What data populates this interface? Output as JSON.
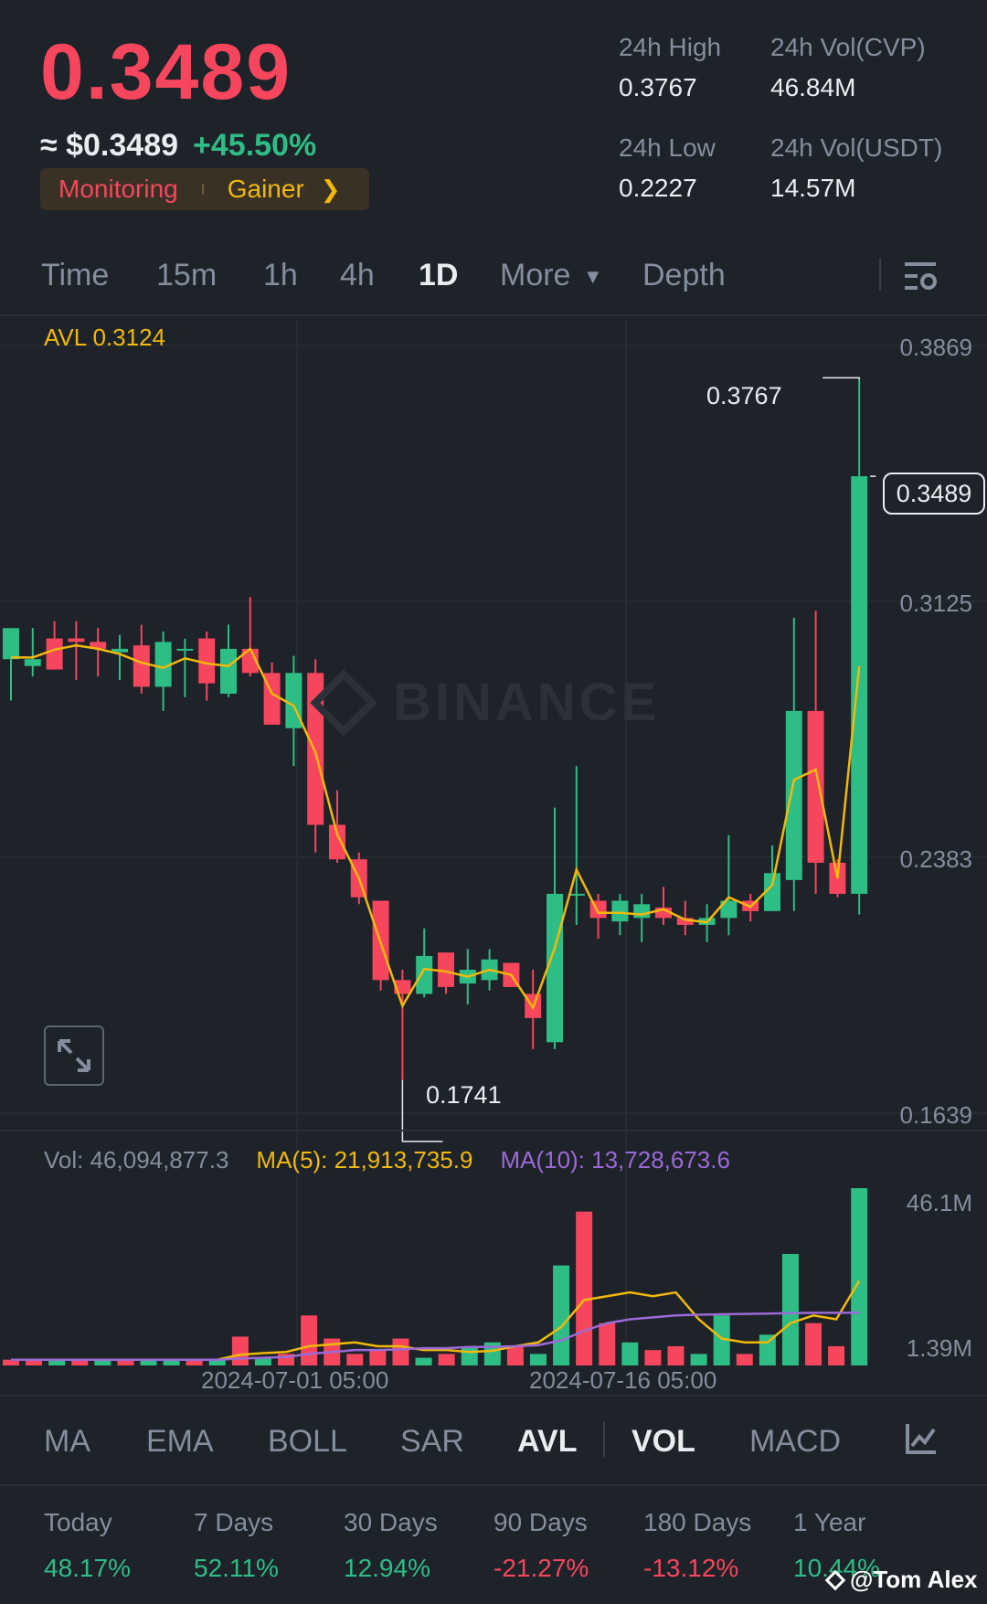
{
  "header": {
    "price": "0.3489",
    "approx": "≈ $0.3489",
    "change": "+45.50%",
    "tag_monitoring": "Monitoring",
    "tag_gainer": "Gainer",
    "stats": {
      "high_label": "24h High",
      "high_value": "0.3767",
      "low_label": "24h Low",
      "low_value": "0.2227",
      "vol_cvp_label": "24h Vol(CVP)",
      "vol_cvp_value": "46.84M",
      "vol_usdt_label": "24h Vol(USDT)",
      "vol_usdt_value": "14.57M"
    }
  },
  "timeframes": [
    "Time",
    "15m",
    "1h",
    "4h",
    "1D",
    "More",
    "Depth"
  ],
  "active_timeframe": "1D",
  "chart": {
    "avl_label": "AVL 0.3124",
    "y_labels": [
      "0.3869",
      "0.3125",
      "0.2383",
      "0.1639"
    ],
    "current_price_badge": "0.3489",
    "high_marker": "0.3767",
    "low_marker": "0.1741",
    "watermark": "BINANCE",
    "vol_legend": {
      "vol": "Vol: 46,094,877.3",
      "ma5": "MA(5): 21,913,735.9",
      "ma10": "MA(10): 13,728,673.6"
    },
    "vol_y_labels": [
      "46.1M",
      "1.39M"
    ],
    "date_labels": [
      "2024-07-01 05:00",
      "2024-07-16 05:00"
    ]
  },
  "indicators": [
    "MA",
    "EMA",
    "BOLL",
    "SAR",
    "AVL",
    "VOL",
    "MACD"
  ],
  "active_indicators": [
    "AVL",
    "VOL"
  ],
  "periods": [
    {
      "label": "Today",
      "value": "48.17%",
      "dir": "pos"
    },
    {
      "label": "7 Days",
      "value": "52.11%",
      "dir": "pos"
    },
    {
      "label": "30 Days",
      "value": "12.94%",
      "dir": "pos"
    },
    {
      "label": "90 Days",
      "value": "-21.27%",
      "dir": "neg"
    },
    {
      "label": "180 Days",
      "value": "-13.12%",
      "dir": "neg"
    },
    {
      "label": "1 Year",
      "value": "10.44%",
      "dir": "pos"
    }
  ],
  "credit": "@Tom Alex",
  "colors": {
    "up": "#2ebd85",
    "down": "#f6465d",
    "accent": "#f0b90b",
    "ma10": "#9c6ad6",
    "bg": "#1e2229"
  },
  "chart_data": {
    "type": "candlestick",
    "y_range": [
      0.1639,
      0.3869
    ],
    "volume_range": [
      0,
      46.1
    ],
    "volume_unit": "M",
    "candles": [
      {
        "o": 0.296,
        "h": 0.301,
        "l": 0.284,
        "c": 0.305
      },
      {
        "o": 0.294,
        "h": 0.305,
        "l": 0.291,
        "c": 0.296
      },
      {
        "o": 0.302,
        "h": 0.307,
        "l": 0.293,
        "c": 0.293
      },
      {
        "o": 0.302,
        "h": 0.307,
        "l": 0.29,
        "c": 0.301
      },
      {
        "o": 0.301,
        "h": 0.305,
        "l": 0.291,
        "c": 0.299
      },
      {
        "o": 0.298,
        "h": 0.303,
        "l": 0.29,
        "c": 0.299
      },
      {
        "o": 0.3,
        "h": 0.306,
        "l": 0.286,
        "c": 0.288
      },
      {
        "o": 0.288,
        "h": 0.304,
        "l": 0.281,
        "c": 0.301
      },
      {
        "o": 0.299,
        "h": 0.302,
        "l": 0.285,
        "c": 0.299
      },
      {
        "o": 0.302,
        "h": 0.304,
        "l": 0.284,
        "c": 0.289
      },
      {
        "o": 0.286,
        "h": 0.306,
        "l": 0.285,
        "c": 0.299
      },
      {
        "o": 0.299,
        "h": 0.314,
        "l": 0.291,
        "c": 0.292
      },
      {
        "o": 0.292,
        "h": 0.295,
        "l": 0.28,
        "c": 0.277
      },
      {
        "o": 0.276,
        "h": 0.297,
        "l": 0.265,
        "c": 0.292
      },
      {
        "o": 0.292,
        "h": 0.296,
        "l": 0.24,
        "c": 0.248
      },
      {
        "o": 0.248,
        "h": 0.258,
        "l": 0.237,
        "c": 0.238
      },
      {
        "o": 0.238,
        "h": 0.24,
        "l": 0.225,
        "c": 0.227
      },
      {
        "o": 0.226,
        "h": 0.226,
        "l": 0.2,
        "c": 0.203
      },
      {
        "o": 0.203,
        "h": 0.206,
        "l": 0.174,
        "c": 0.199
      },
      {
        "o": 0.199,
        "h": 0.218,
        "l": 0.198,
        "c": 0.21
      },
      {
        "o": 0.211,
        "h": 0.211,
        "l": 0.199,
        "c": 0.201
      },
      {
        "o": 0.202,
        "h": 0.212,
        "l": 0.196,
        "c": 0.206
      },
      {
        "o": 0.203,
        "h": 0.212,
        "l": 0.2,
        "c": 0.209
      },
      {
        "o": 0.208,
        "h": 0.208,
        "l": 0.201,
        "c": 0.201
      },
      {
        "o": 0.199,
        "h": 0.206,
        "l": 0.183,
        "c": 0.192
      },
      {
        "o": 0.185,
        "h": 0.253,
        "l": 0.183,
        "c": 0.228
      },
      {
        "o": 0.228,
        "h": 0.265,
        "l": 0.219,
        "c": 0.228
      },
      {
        "o": 0.226,
        "h": 0.228,
        "l": 0.215,
        "c": 0.221
      },
      {
        "o": 0.22,
        "h": 0.228,
        "l": 0.216,
        "c": 0.226
      },
      {
        "o": 0.221,
        "h": 0.228,
        "l": 0.214,
        "c": 0.225
      },
      {
        "o": 0.224,
        "h": 0.23,
        "l": 0.219,
        "c": 0.221
      },
      {
        "o": 0.221,
        "h": 0.226,
        "l": 0.216,
        "c": 0.219
      },
      {
        "o": 0.219,
        "h": 0.225,
        "l": 0.214,
        "c": 0.221
      },
      {
        "o": 0.221,
        "h": 0.245,
        "l": 0.216,
        "c": 0.226
      },
      {
        "o": 0.226,
        "h": 0.228,
        "l": 0.22,
        "c": 0.223
      },
      {
        "o": 0.223,
        "h": 0.242,
        "l": 0.223,
        "c": 0.234
      },
      {
        "o": 0.232,
        "h": 0.308,
        "l": 0.223,
        "c": 0.281
      },
      {
        "o": 0.281,
        "h": 0.31,
        "l": 0.228,
        "c": 0.237
      },
      {
        "o": 0.237,
        "h": 0.238,
        "l": 0.227,
        "c": 0.228
      },
      {
        "o": 0.228,
        "h": 0.377,
        "l": 0.222,
        "c": 0.349
      }
    ],
    "volume": [
      {
        "v": 1.5,
        "up": false
      },
      {
        "v": 1.6,
        "up": false
      },
      {
        "v": 1.4,
        "up": true
      },
      {
        "v": 1.6,
        "up": false
      },
      {
        "v": 1.5,
        "up": true
      },
      {
        "v": 1.6,
        "up": false
      },
      {
        "v": 1.4,
        "up": true
      },
      {
        "v": 1.5,
        "up": true
      },
      {
        "v": 1.4,
        "up": false
      },
      {
        "v": 1.6,
        "up": true
      },
      {
        "v": 7.5,
        "up": false
      },
      {
        "v": 2.0,
        "up": true
      },
      {
        "v": 3.0,
        "up": false
      },
      {
        "v": 13.0,
        "up": false
      },
      {
        "v": 7.0,
        "up": false
      },
      {
        "v": 3.0,
        "up": false
      },
      {
        "v": 4.0,
        "up": false
      },
      {
        "v": 7.0,
        "up": false
      },
      {
        "v": 2.0,
        "up": true
      },
      {
        "v": 3.0,
        "up": false
      },
      {
        "v": 5.0,
        "up": true
      },
      {
        "v": 6.0,
        "up": true
      },
      {
        "v": 5.0,
        "up": false
      },
      {
        "v": 3.0,
        "up": true
      },
      {
        "v": 26.0,
        "up": true
      },
      {
        "v": 40.0,
        "up": false
      },
      {
        "v": 11.0,
        "up": false
      },
      {
        "v": 6.0,
        "up": true
      },
      {
        "v": 4.0,
        "up": false
      },
      {
        "v": 5.0,
        "up": false
      },
      {
        "v": 3.0,
        "up": true
      },
      {
        "v": 13.0,
        "up": true
      },
      {
        "v": 3.0,
        "up": false
      },
      {
        "v": 8.0,
        "up": true
      },
      {
        "v": 29.0,
        "up": true
      },
      {
        "v": 11.0,
        "up": false
      },
      {
        "v": 5.0,
        "up": false
      },
      {
        "v": 46.1,
        "up": true
      }
    ],
    "ma5": [
      1.5,
      1.5,
      1.5,
      1.5,
      1.5,
      1.5,
      1.5,
      1.5,
      1.5,
      1.5,
      2.8,
      3.2,
      3.5,
      5.0,
      5.5,
      6.0,
      5.0,
      5.0,
      4.0,
      4.0,
      3.5,
      3.8,
      5.0,
      6.0,
      10.0,
      17.0,
      18.0,
      19.0,
      18.0,
      19.0,
      12.0,
      7.0,
      6.0,
      6.0,
      11.0,
      13.0,
      12.0,
      22.0
    ],
    "ma10": [
      1.5,
      1.5,
      1.5,
      1.5,
      1.5,
      1.5,
      1.5,
      1.5,
      1.5,
      1.5,
      1.8,
      2.0,
      2.2,
      3.0,
      3.5,
      4.0,
      4.0,
      4.2,
      4.5,
      4.5,
      4.8,
      4.8,
      5.0,
      5.3,
      6.5,
      9.0,
      11.0,
      12.0,
      12.5,
      13.0,
      13.2,
      13.3,
      13.4,
      13.5,
      13.6,
      13.7,
      13.7,
      13.73
    ]
  }
}
